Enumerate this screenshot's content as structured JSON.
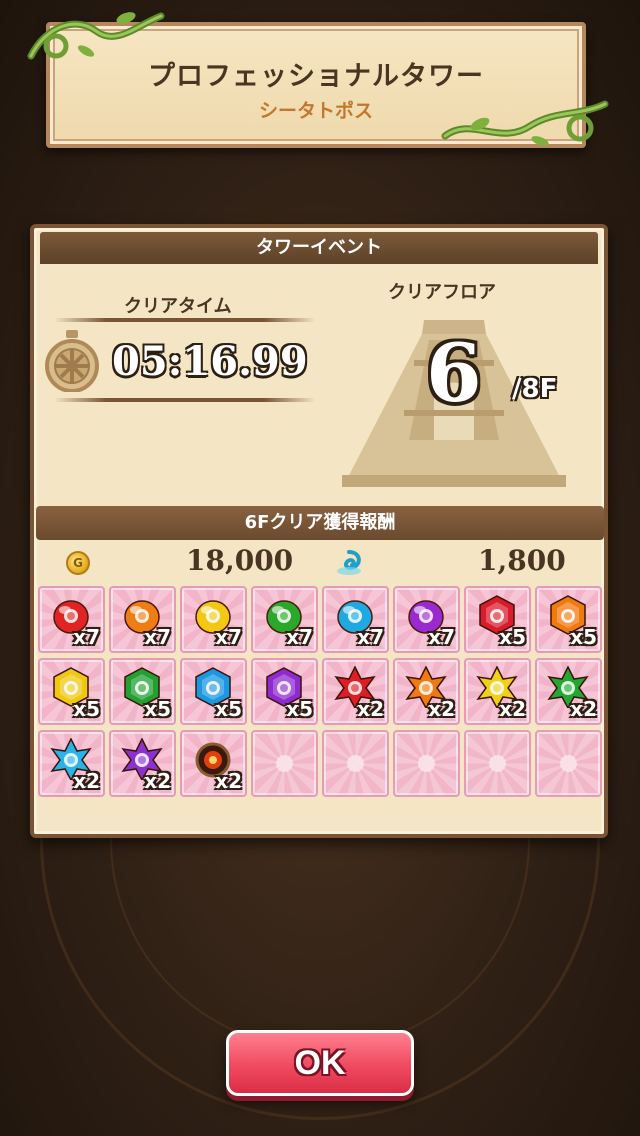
{
  "title": {
    "main": "プロフェッショナルタワー",
    "sub": "シータトポス"
  },
  "panel": {
    "header": "タワーイベント",
    "clear_time_label": "クリアタイム",
    "clear_time": "05:16.99",
    "clear_floor_label": "クリアフロア",
    "clear_floor": "6",
    "total_floors": "/8F"
  },
  "rewards": {
    "header": "6Fクリア獲得報酬",
    "coin_icon_glyph": "G",
    "coins": "18,000",
    "orbs": "1,800",
    "items": [
      {
        "icon": "red-egg-icon",
        "color": "#e02424",
        "shape": "egg",
        "qty": "x7"
      },
      {
        "icon": "orange-egg-icon",
        "color": "#f07d14",
        "shape": "egg",
        "qty": "x7"
      },
      {
        "icon": "yellow-egg-icon",
        "color": "#f2c814",
        "shape": "egg",
        "qty": "x7"
      },
      {
        "icon": "green-egg-icon",
        "color": "#2aa82a",
        "shape": "egg",
        "qty": "x7"
      },
      {
        "icon": "cyan-egg-icon",
        "color": "#20a8e0",
        "shape": "egg",
        "qty": "x7"
      },
      {
        "icon": "purple-egg-icon",
        "color": "#9a2ad0",
        "shape": "egg",
        "qty": "x7"
      },
      {
        "icon": "red-hexagon-gem-icon",
        "color": "#d81c2c",
        "shape": "hex",
        "qty": "x5"
      },
      {
        "icon": "orange-hexagon-gem-icon",
        "color": "#f07a10",
        "shape": "hex",
        "qty": "x5"
      },
      {
        "icon": "yellow-hexagon-gem-icon",
        "color": "#f0c810",
        "shape": "hex",
        "qty": "x5"
      },
      {
        "icon": "green-hexagon-gem-icon",
        "color": "#22a030",
        "shape": "hex",
        "qty": "x5"
      },
      {
        "icon": "blue-hexagon-gem-icon",
        "color": "#1a98e0",
        "shape": "hex",
        "qty": "x5"
      },
      {
        "icon": "purple-hexagon-gem-icon",
        "color": "#8e2ad0",
        "shape": "hex",
        "qty": "x5"
      },
      {
        "icon": "red-star-gem-icon",
        "color": "#e01c24",
        "shape": "star",
        "qty": "x2"
      },
      {
        "icon": "orange-star-gem-icon",
        "color": "#f07a10",
        "shape": "star",
        "qty": "x2"
      },
      {
        "icon": "yellow-star-gem-icon",
        "color": "#f0d018",
        "shape": "star",
        "qty": "x2"
      },
      {
        "icon": "green-star-gem-icon",
        "color": "#22a830",
        "shape": "star",
        "qty": "x2"
      },
      {
        "icon": "cyan-star-gem-icon",
        "color": "#28b4e8",
        "shape": "star",
        "qty": "x2"
      },
      {
        "icon": "purple-star-gem-icon",
        "color": "#8e30d0",
        "shape": "star",
        "qty": "x2"
      },
      {
        "icon": "fire-orb-icon",
        "color": "#e0400c",
        "shape": "orb",
        "qty": "x2"
      }
    ],
    "empty_slots": 5
  },
  "ok_button": "OK",
  "colors": {
    "panel_bg": "#f4e6c4",
    "header_brown": "#6a4a2e",
    "ok_red": "#f04a60",
    "title_orange": "#c4772a"
  }
}
